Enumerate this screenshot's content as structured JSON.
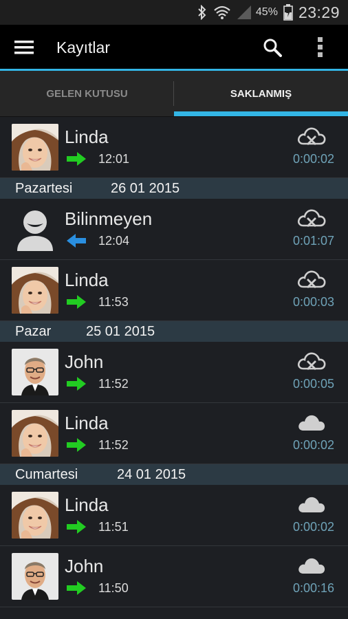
{
  "status_bar": {
    "battery_percent": "45%",
    "clock": "23:29",
    "icons": [
      "bluetooth-icon",
      "wifi-icon",
      "signal-icon",
      "battery-charging-icon"
    ]
  },
  "action_bar": {
    "title": "Kayıtlar",
    "icons": [
      "menu-icon",
      "search-icon",
      "overflow-menu-icon"
    ]
  },
  "tabs": [
    {
      "label": "GELEN KUTUSU",
      "active": false
    },
    {
      "label": "SAKLANMIŞ",
      "active": true
    }
  ],
  "colors": {
    "accent": "#33b5e5",
    "outgoing_arrow": "#22cc22",
    "incoming_arrow": "#2a8fe0",
    "duration": "#6fa3b8"
  },
  "list": {
    "row0": {
      "name": "Linda",
      "direction": "outgoing",
      "time": "12:01",
      "duration": "0:00:02",
      "cloud": "cloud-sync-off-icon"
    },
    "header1": {
      "day": "Pazartesi",
      "date": "26 01 2015"
    },
    "row1": {
      "name": "Bilinmeyen",
      "direction": "incoming",
      "time": "12:04",
      "duration": "0:01:07",
      "cloud": "cloud-sync-off-icon"
    },
    "row2": {
      "name": "Linda",
      "direction": "outgoing",
      "time": "11:53",
      "duration": "0:00:03",
      "cloud": "cloud-sync-off-icon"
    },
    "header2": {
      "day": "Pazar",
      "date": "25 01 2015"
    },
    "row3": {
      "name": "John",
      "direction": "outgoing",
      "time": "11:52",
      "duration": "0:00:05",
      "cloud": "cloud-sync-off-icon"
    },
    "row4": {
      "name": "Linda",
      "direction": "outgoing",
      "time": "11:52",
      "duration": "0:00:02",
      "cloud": "cloud-icon"
    },
    "header3": {
      "day": "Cumartesi",
      "date": "24 01 2015"
    },
    "row5": {
      "name": "Linda",
      "direction": "outgoing",
      "time": "11:51",
      "duration": "0:00:02",
      "cloud": "cloud-icon"
    },
    "row6": {
      "name": "John",
      "direction": "outgoing",
      "time": "11:50",
      "duration": "0:00:16",
      "cloud": "cloud-icon"
    }
  }
}
